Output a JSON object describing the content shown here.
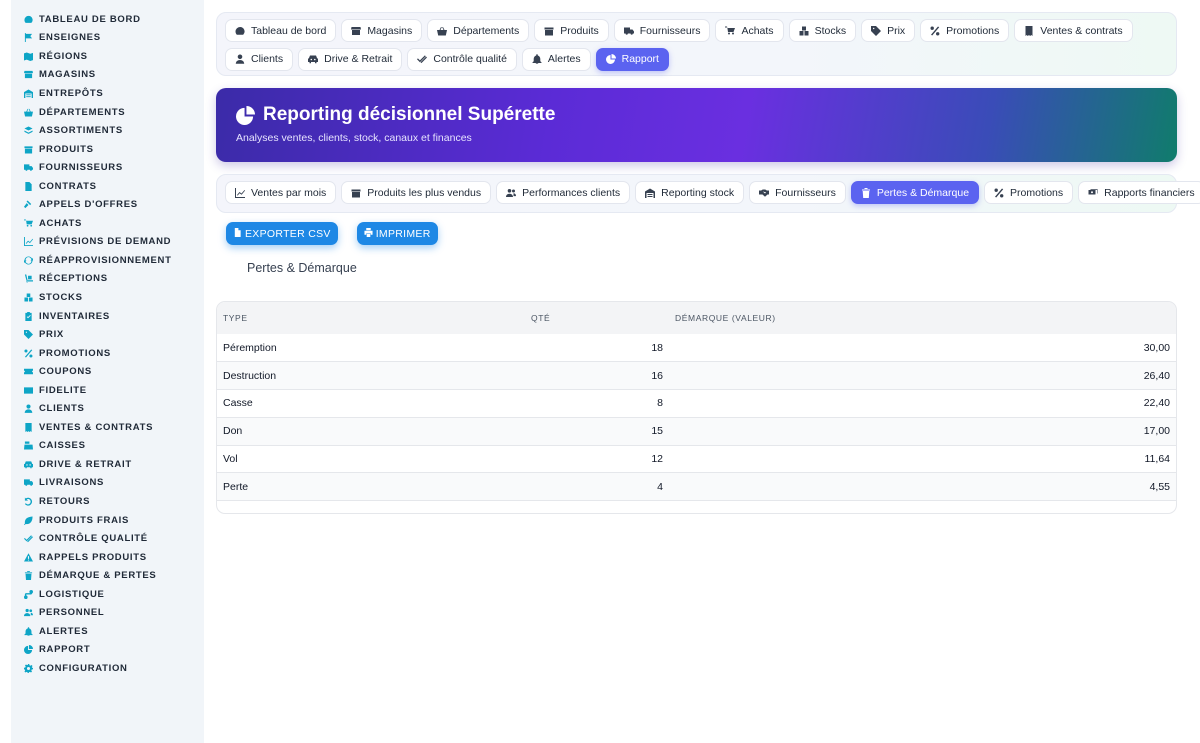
{
  "sidebar": {
    "items": [
      {
        "label": "TABLEAU DE BORD",
        "icon": "dashboard-icon"
      },
      {
        "label": "ENSEIGNES",
        "icon": "flag-icon"
      },
      {
        "label": "RÉGIONS",
        "icon": "map-icon"
      },
      {
        "label": "MAGASINS",
        "icon": "store-icon"
      },
      {
        "label": "ENTREPÔTS",
        "icon": "warehouse-icon"
      },
      {
        "label": "DÉPARTEMENTS",
        "icon": "basket-icon"
      },
      {
        "label": "ASSORTIMENTS",
        "icon": "layers-icon"
      },
      {
        "label": "PRODUITS",
        "icon": "box-icon"
      },
      {
        "label": "FOURNISSEURS",
        "icon": "truck-icon"
      },
      {
        "label": "CONTRATS",
        "icon": "file-icon"
      },
      {
        "label": "APPELS D'OFFRES",
        "icon": "gavel-icon"
      },
      {
        "label": "ACHATS",
        "icon": "cart-icon"
      },
      {
        "label": "PRÉVISIONS DE DEMAND",
        "icon": "chart-line-icon"
      },
      {
        "label": "RÉAPPROVISIONNEMENT",
        "icon": "sync-icon"
      },
      {
        "label": "RÉCEPTIONS",
        "icon": "dolly-icon"
      },
      {
        "label": "STOCKS",
        "icon": "boxes-icon"
      },
      {
        "label": "INVENTAIRES",
        "icon": "clipboard-check-icon"
      },
      {
        "label": "PRIX",
        "icon": "tag-icon"
      },
      {
        "label": "PROMOTIONS",
        "icon": "percent-icon"
      },
      {
        "label": "COUPONS",
        "icon": "ticket-icon"
      },
      {
        "label": "FIDELITE",
        "icon": "id-card-icon"
      },
      {
        "label": "CLIENTS",
        "icon": "user-icon"
      },
      {
        "label": "VENTES & CONTRATS",
        "icon": "receipt-icon"
      },
      {
        "label": "CAISSES",
        "icon": "cash-register-icon"
      },
      {
        "label": "DRIVE & RETRAIT",
        "icon": "car-icon"
      },
      {
        "label": "LIVRAISONS",
        "icon": "delivery-truck-icon"
      },
      {
        "label": "RETOURS",
        "icon": "undo-icon"
      },
      {
        "label": "PRODUITS FRAIS",
        "icon": "leaf-icon"
      },
      {
        "label": "CONTRÔLE QUALITÉ",
        "icon": "check-double-icon"
      },
      {
        "label": "RAPPELS PRODUITS",
        "icon": "warning-icon"
      },
      {
        "label": "DÉMARQUE & PERTES",
        "icon": "trash-icon"
      },
      {
        "label": "LOGISTIQUE",
        "icon": "route-icon"
      },
      {
        "label": "PERSONNEL",
        "icon": "users-icon"
      },
      {
        "label": "ALERTES",
        "icon": "bell-icon"
      },
      {
        "label": "RAPPORT",
        "icon": "pie-chart-icon"
      },
      {
        "label": "CONFIGURATION",
        "icon": "gear-icon"
      }
    ]
  },
  "topnav": {
    "items": [
      {
        "label": "Tableau de bord",
        "icon": "dashboard-icon",
        "active": false
      },
      {
        "label": "Magasins",
        "icon": "store-icon",
        "active": false
      },
      {
        "label": "Départements",
        "icon": "basket-icon",
        "active": false
      },
      {
        "label": "Produits",
        "icon": "box-icon",
        "active": false
      },
      {
        "label": "Fournisseurs",
        "icon": "truck-icon",
        "active": false
      },
      {
        "label": "Achats",
        "icon": "cart-icon",
        "active": false
      },
      {
        "label": "Stocks",
        "icon": "boxes-icon",
        "active": false
      },
      {
        "label": "Prix",
        "icon": "tag-icon",
        "active": false
      },
      {
        "label": "Promotions",
        "icon": "percent-icon",
        "active": false
      },
      {
        "label": "Ventes & contrats",
        "icon": "receipt-icon",
        "active": false
      },
      {
        "label": "Clients",
        "icon": "user-icon",
        "active": false
      },
      {
        "label": "Drive & Retrait",
        "icon": "car-icon",
        "active": false
      },
      {
        "label": "Contrôle qualité",
        "icon": "check-double-icon",
        "active": false
      },
      {
        "label": "Alertes",
        "icon": "bell-icon",
        "active": false
      },
      {
        "label": "Rapport",
        "icon": "pie-chart-icon",
        "active": true
      }
    ]
  },
  "banner": {
    "title": "Reporting décisionnel Supérette",
    "subtitle": "Analyses ventes, clients, stock, canaux et finances",
    "icon": "pie-chart-icon"
  },
  "subnav": {
    "items": [
      {
        "label": "Ventes par mois",
        "icon": "chart-line-icon",
        "active": false
      },
      {
        "label": "Produits les plus vendus",
        "icon": "box-icon",
        "active": false
      },
      {
        "label": "Performances clients",
        "icon": "users-icon",
        "active": false
      },
      {
        "label": "Reporting stock",
        "icon": "warehouse-icon",
        "active": false
      },
      {
        "label": "Fournisseurs",
        "icon": "handshake-icon",
        "active": false
      },
      {
        "label": "Pertes & Démarque",
        "icon": "trash-icon",
        "active": true
      },
      {
        "label": "Promotions",
        "icon": "percent-icon",
        "active": false
      },
      {
        "label": "Rapports financiers",
        "icon": "money-icon",
        "active": false
      }
    ]
  },
  "actions": {
    "export_label": "EXPORTER CSV",
    "print_label": "IMPRIMER"
  },
  "section": {
    "title": "Pertes & Démarque"
  },
  "table": {
    "columns": [
      "TYPE",
      "QTÉ",
      "DÉMARQUE (VALEUR)"
    ],
    "rows": [
      [
        "Péremption",
        "18",
        "30,00"
      ],
      [
        "Destruction",
        "16",
        "26,40"
      ],
      [
        "Casse",
        "8",
        "22,40"
      ],
      [
        "Don",
        "15",
        "17,00"
      ],
      [
        "Vol",
        "12",
        "11,64"
      ],
      [
        "Perte",
        "4",
        "4,55"
      ]
    ]
  },
  "colors": {
    "accent": "#5b63f0",
    "icon": "#0ea5c6",
    "button": "#1e88e5"
  }
}
